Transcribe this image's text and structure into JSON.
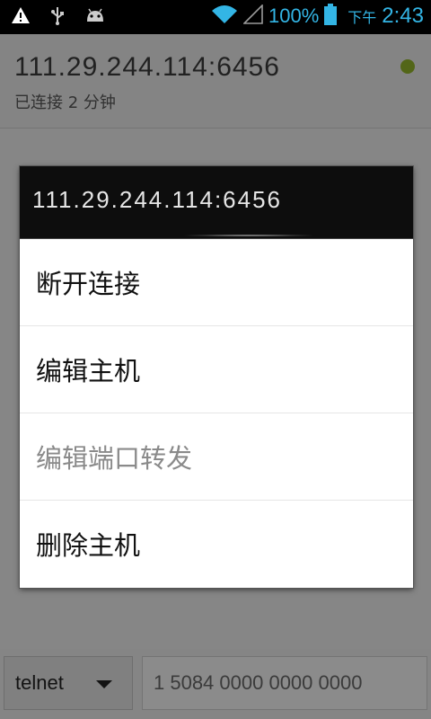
{
  "status_bar": {
    "icons_left": [
      "warning-icon",
      "usb-icon",
      "android-debug-icon"
    ],
    "icons_right": [
      "wifi-icon",
      "signal-icon",
      "battery-icon"
    ],
    "battery_level": "100%",
    "ampm": "下午",
    "time": "2:43",
    "accent": "#33b5e5"
  },
  "host": {
    "name": "111.29.244.114:6456",
    "status": "已连接 2 分钟",
    "status_color": "#8fb02a"
  },
  "dialog": {
    "title": "111.29.244.114:6456",
    "menu": [
      {
        "label": "断开连接",
        "enabled": true
      },
      {
        "label": "编辑主机",
        "enabled": true
      },
      {
        "label": "编辑端口转发",
        "enabled": false
      },
      {
        "label": "删除主机",
        "enabled": true
      }
    ]
  },
  "bottom_bar": {
    "protocol": "telnet",
    "host_input_value": "1 5084 0000 0000 0000"
  }
}
